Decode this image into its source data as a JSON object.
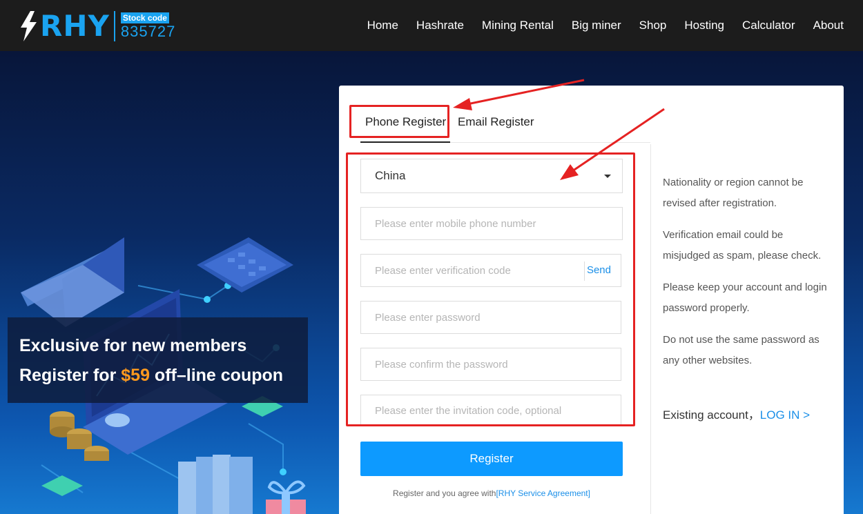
{
  "header": {
    "logo_text": "RHY",
    "stock_label": "Stock code",
    "stock_code": "835727",
    "nav": [
      "Home",
      "Hashrate",
      "Mining Rental",
      "Big miner",
      "Shop",
      "Hosting",
      "Calculator",
      "About"
    ]
  },
  "promo": {
    "line1": "Exclusive for new members",
    "line2_prefix": "Register for ",
    "line2_price": "$59",
    "line2_suffix": " off–line coupon"
  },
  "register": {
    "tabs": [
      "Phone Register",
      "Email Register"
    ],
    "active_tab": "Phone Register",
    "country": "China",
    "phone_placeholder": "Please enter mobile phone number",
    "code_placeholder": "Please enter verification code",
    "send_label": "Send",
    "password_placeholder": "Please enter password",
    "confirm_placeholder": "Please confirm the password",
    "invite_placeholder": "Please enter the invitation code, optional",
    "submit_label": "Register",
    "agree_prefix": "Register and you agree with",
    "agree_link": "[RHY Service Agreement]"
  },
  "notes": [
    "Nationality or region cannot be revised after registration.",
    "Verification email could be misjudged as spam, please check.",
    "Please keep your account and login password properly.",
    "Do not use the same password as any other websites."
  ],
  "existing": {
    "prefix": "Existing account，",
    "login": "LOG IN >"
  },
  "colors": {
    "accent": "#0d9aff",
    "annotation": "#e52222",
    "promo_price": "#ff9a1e"
  }
}
